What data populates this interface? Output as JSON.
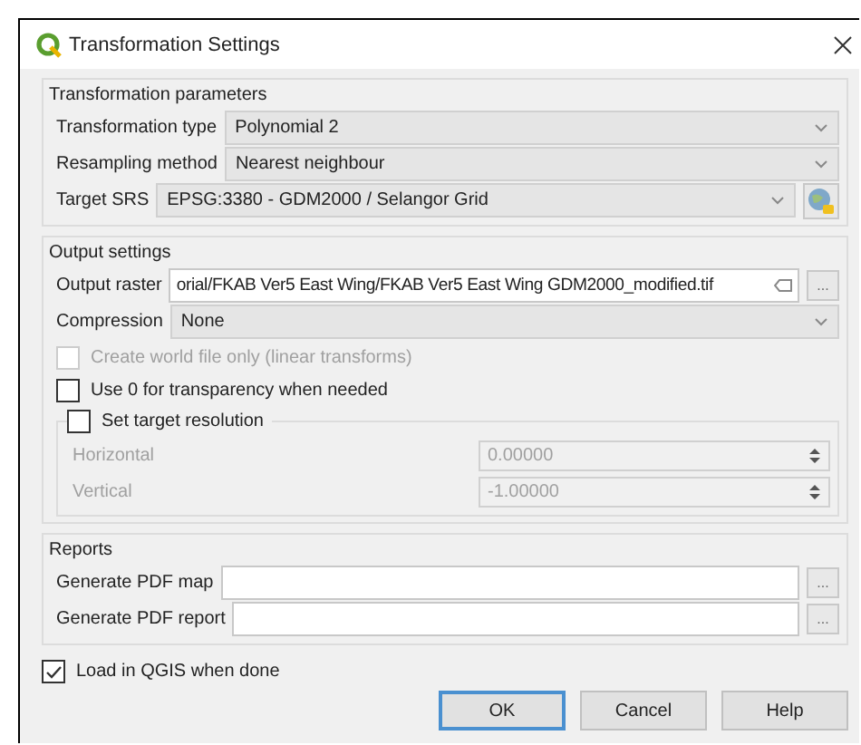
{
  "window": {
    "title": "Transformation Settings"
  },
  "transformation_parameters": {
    "title": "Transformation parameters",
    "rows": [
      {
        "kind": "combo",
        "label": "Transformation type",
        "value": "Polynomial 2"
      },
      {
        "kind": "combo",
        "label": "Resampling method",
        "value": "Nearest neighbour"
      },
      {
        "kind": "crs",
        "label": "Target SRS",
        "value": "EPSG:3380 - GDM2000 / Selangor Grid"
      }
    ]
  },
  "output_settings": {
    "title": "Output settings",
    "rows": [
      {
        "kind": "file",
        "label": "Output raster",
        "value": "orial/FKAB Ver5 East Wing/FKAB Ver5 East Wing GDM2000_modified.tif",
        "browse": "..."
      },
      {
        "kind": "combo",
        "label": "Compression",
        "value": "None"
      }
    ],
    "checkboxes": [
      {
        "label": "Create world file only (linear transforms)",
        "checked": false,
        "disabled": true
      },
      {
        "label": "Use 0 for transparency when needed",
        "checked": false,
        "disabled": false
      }
    ],
    "resolution": {
      "title": "Set target resolution",
      "checked": false,
      "fields": [
        {
          "label": "Horizontal",
          "value": "0.00000",
          "disabled": true
        },
        {
          "label": "Vertical",
          "value": "-1.00000",
          "disabled": true
        }
      ]
    }
  },
  "reports": {
    "title": "Reports",
    "rows": [
      {
        "kind": "file",
        "label": "Generate PDF map",
        "browse": "..."
      },
      {
        "kind": "file",
        "label": "Generate PDF report",
        "browse": "..."
      }
    ]
  },
  "load_in_qgis": {
    "label": "Load in QGIS when done",
    "checked": true
  },
  "buttons": [
    {
      "label": "OK",
      "default": true
    },
    {
      "label": "Cancel",
      "default": false
    },
    {
      "label": "Help",
      "default": false
    }
  ]
}
